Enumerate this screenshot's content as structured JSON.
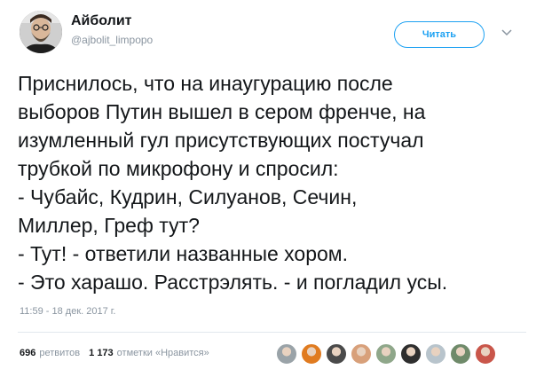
{
  "author": {
    "display_name": "Айболит",
    "handle": "@ajbolit_limpopo",
    "avatar_icon": "bearded-man-avatar-icon"
  },
  "follow_button": {
    "label": "Читать",
    "color": "#1da1f2"
  },
  "menu_icon": "chevron-down-icon",
  "tweet": {
    "lines": [
      "Приснилось, что на инаугурацию после",
      "выборов Путин вышел в сером френче, на",
      "изумленный гул присутствующих постучал",
      "трубкой по микрофону и спросил:",
      "- Чубайс, Кудрин, Силуанов, Сечин,",
      "Миллер, Греф тут?",
      "- Тут! - ответили названные хором.",
      "- Это харашо. Расстрэлять. - и погладил усы."
    ],
    "timestamp": "11:59 - 18 дек. 2017 г."
  },
  "stats": {
    "retweets_count": "696",
    "retweets_label": "ретвитов",
    "likes_count": "1 173",
    "likes_label": "отметки «Нравится»"
  },
  "likers": [
    {
      "name": "liker-avatar-1",
      "color": "#9aa3a8"
    },
    {
      "name": "liker-avatar-2",
      "color": "#e07b20"
    },
    {
      "name": "liker-avatar-3",
      "color": "#4a4a4a"
    },
    {
      "name": "liker-avatar-4",
      "color": "#d8a07a"
    },
    {
      "name": "liker-avatar-5",
      "color": "#8fa78a"
    },
    {
      "name": "liker-avatar-6",
      "color": "#2e2e2e"
    },
    {
      "name": "liker-avatar-7",
      "color": "#b8c4cc"
    },
    {
      "name": "liker-avatar-8",
      "color": "#6f8a6a"
    },
    {
      "name": "liker-avatar-9",
      "color": "#c9564a"
    }
  ]
}
